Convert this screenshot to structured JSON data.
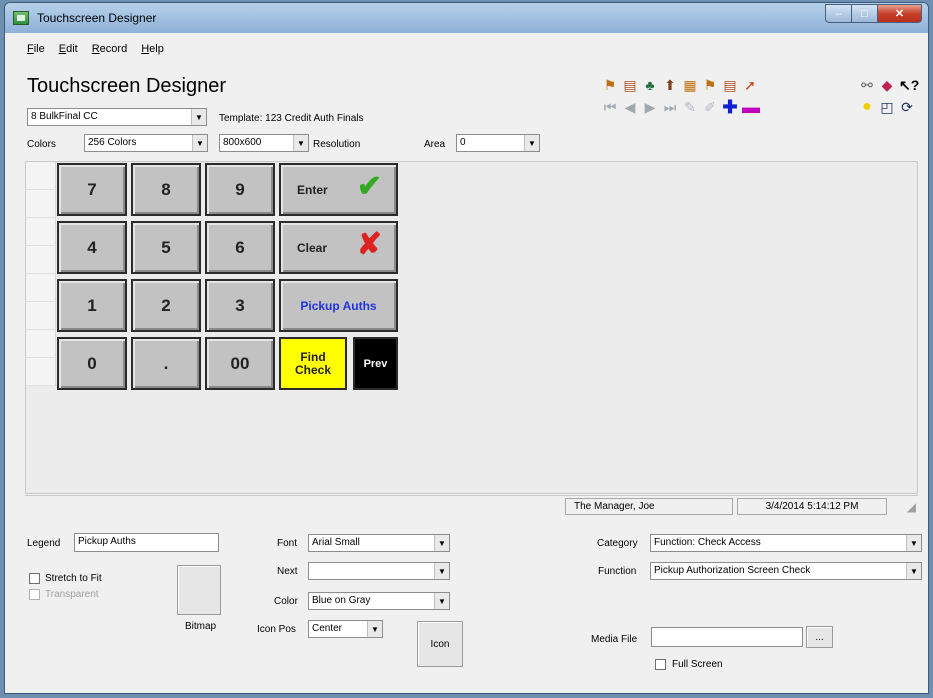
{
  "window": {
    "title": "Touchscreen Designer",
    "controls": {
      "minimize": "–",
      "maximize": "□",
      "close": "✕"
    }
  },
  "menu": [
    {
      "label": "File",
      "mnemonic": "F",
      "rest": "ile"
    },
    {
      "label": "Edit",
      "mnemonic": "E",
      "rest": "dit"
    },
    {
      "label": "Record",
      "mnemonic": "R",
      "rest": "ecord"
    },
    {
      "label": "Help",
      "mnemonic": "H",
      "rest": "elp"
    }
  ],
  "header": {
    "title": "Touchscreen Designer",
    "screen_select": "8  BulkFinal CC",
    "template_label": "Template: 123 Credit Auth Finals",
    "colors_label": "Colors",
    "colors_value": "256 Colors",
    "resolution_value": "800x600",
    "resolution_label": "Resolution",
    "area_label": "Area",
    "area_value": "0"
  },
  "toolbar": {
    "row1_icons": [
      "flag-icon",
      "page-icon",
      "tree-icon",
      "pin-icon",
      "grid-icon",
      "flag-icon",
      "page-icon",
      "arrow-icon"
    ],
    "row2_icons": [
      "first-record-icon",
      "prev-record-icon",
      "next-record-icon",
      "last-record-icon",
      "edit-record-icon",
      "cancel-edit-icon",
      "add-record-icon",
      "delete-record-icon"
    ],
    "right_icons": [
      "binoculars-icon",
      "eraser-icon",
      "help-pointer-icon",
      "lightbulb-icon",
      "window-icon",
      "refresh-icon"
    ]
  },
  "keypad": {
    "keys": [
      {
        "label": "7"
      },
      {
        "label": "8"
      },
      {
        "label": "9"
      },
      {
        "label": "4"
      },
      {
        "label": "5"
      },
      {
        "label": "6"
      },
      {
        "label": "1"
      },
      {
        "label": "2"
      },
      {
        "label": "3"
      },
      {
        "label": "0"
      },
      {
        "label": "."
      },
      {
        "label": "00"
      }
    ],
    "enter": "Enter",
    "clear": "Clear",
    "pickup": "Pickup Auths",
    "find_check_line1": "Find",
    "find_check_line2": "Check",
    "prev": "Prev"
  },
  "status": {
    "user": "The Manager, Joe",
    "datetime": "3/4/2014 5:14:12 PM"
  },
  "properties": {
    "legend_label": "Legend",
    "legend_value": "Pickup Auths",
    "stretch_label": "Stretch to Fit",
    "transparent_label": "Transparent",
    "bitmap_label": "Bitmap",
    "font_label": "Font",
    "font_value": "Arial Small",
    "next_label": "Next",
    "next_value": "",
    "color_label": "Color",
    "color_value": "Blue on Gray",
    "iconpos_label": "Icon Pos",
    "iconpos_value": "Center",
    "icon_button": "Icon",
    "category_label": "Category",
    "category_value": "Function: Check Access",
    "function_label": "Function",
    "function_value": "Pickup Authorization Screen Check",
    "mediafile_label": "Media File",
    "mediafile_value": "",
    "browse_button": "...",
    "fullscreen_label": "Full Screen"
  },
  "colors": {
    "find_check_bg": "#ffff00",
    "prev_bg": "#000000",
    "pickup_text": "#2233dd",
    "enter_check": "#33aa22",
    "clear_x": "#dd2222"
  }
}
